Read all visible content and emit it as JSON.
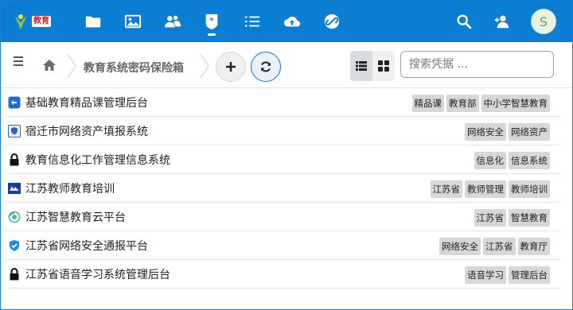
{
  "topbar": {
    "logo_text": "教育",
    "nav": [
      {
        "name": "folder-icon"
      },
      {
        "name": "image-icon"
      },
      {
        "name": "users-icon"
      },
      {
        "name": "vault-icon",
        "active": true
      },
      {
        "name": "list-icon"
      },
      {
        "name": "cloud-upload-icon"
      },
      {
        "name": "link-icon"
      }
    ],
    "avatar_letter": "S",
    "colors": {
      "bar": "#0b7dd3",
      "accent": "#1a6fb7"
    }
  },
  "toolbar": {
    "breadcrumb_title": "教育系统密码保险箱",
    "search_placeholder": "搜索凭据 ..."
  },
  "items": [
    {
      "icon": "ke-logo-icon",
      "title": "基础教育精品课管理后台",
      "tags": [
        "精品课",
        "教育部",
        "中小学智慧教育"
      ]
    },
    {
      "icon": "shield-site-icon",
      "title": "宿迁市网络资产填报系统",
      "tags": [
        "网络安全",
        "网络资产"
      ]
    },
    {
      "icon": "lock-icon",
      "title": "教育信息化工作管理信息系统",
      "tags": [
        "信息化",
        "信息系统"
      ]
    },
    {
      "icon": "jsjs-logo-icon",
      "title": "江苏教师教育培训",
      "tags": [
        "江苏省",
        "教师管理",
        "教师培训"
      ]
    },
    {
      "icon": "cloud-ring-icon",
      "title": "江苏智慧教育云平台",
      "tags": [
        "江苏省",
        "智慧教育"
      ]
    },
    {
      "icon": "shield-check-icon",
      "title": "江苏省网络安全通报平台",
      "tags": [
        "网络安全",
        "江苏省",
        "教育厅"
      ]
    },
    {
      "icon": "lock-icon",
      "title": "江苏省语音学习系统管理后台",
      "tags": [
        "语音学习",
        "管理后台"
      ]
    }
  ]
}
